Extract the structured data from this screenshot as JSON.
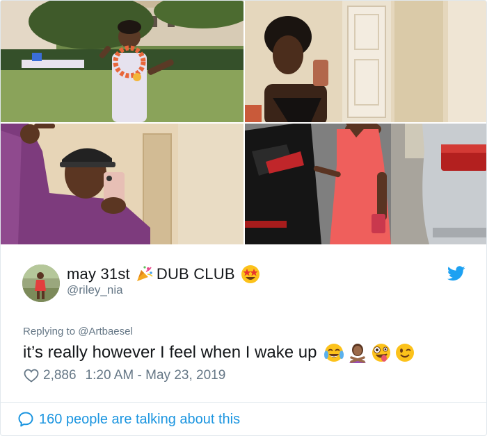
{
  "tweet": {
    "display_name_part1": "may 31st",
    "display_name_part2": "DUB CLUB",
    "display_name_emojis": [
      "party-popper-icon",
      "star-struck-icon"
    ],
    "handle": "@riley_nia",
    "reply_prefix": "Replying to",
    "reply_to": "@Artbaesel",
    "text": "it’s really however I feel when I wake up",
    "text_emojis": [
      "tears-of-joy-icon",
      "person-gesturing-no-icon",
      "zany-face-icon",
      "winking-face-icon"
    ],
    "likes": "2,886",
    "timestamp": "1:20 AM - May 23, 2019",
    "conversation_label": "160 people are talking about this"
  },
  "photos": [
    {
      "name": "photo-outdoor-lei"
    },
    {
      "name": "photo-mirror-selfie-afro"
    },
    {
      "name": "photo-mirror-selfie-cap"
    },
    {
      "name": "photo-red-dress-cars"
    }
  ],
  "colors": {
    "link": "#1b95e0",
    "secondary_text": "#657786",
    "primary_text": "#14171a",
    "twitter_blue": "#1da1f2",
    "border": "#e1e8ed"
  },
  "icons": {
    "brand": "twitter-bird-icon",
    "like": "heart-icon",
    "conversation": "speech-bubble-icon"
  }
}
